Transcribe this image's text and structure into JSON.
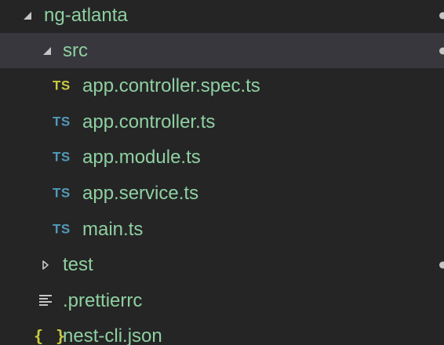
{
  "explorer": {
    "root": {
      "label": "ng-atlanta",
      "expanded": true
    },
    "src_folder": {
      "label": "src",
      "expanded": true
    },
    "src_files": [
      {
        "label": "app.controller.spec.ts",
        "icon": "TS",
        "icon_color": "#cbcb41"
      },
      {
        "label": "app.controller.ts",
        "icon": "TS",
        "icon_color": "#519aba"
      },
      {
        "label": "app.module.ts",
        "icon": "TS",
        "icon_color": "#519aba"
      },
      {
        "label": "app.service.ts",
        "icon": "TS",
        "icon_color": "#519aba"
      },
      {
        "label": "main.ts",
        "icon": "TS",
        "icon_color": "#519aba"
      }
    ],
    "test_folder": {
      "label": "test",
      "expanded": false
    },
    "prettierrc": {
      "label": ".prettierrc"
    },
    "nest_cli": {
      "label": "nest-cli.json",
      "icon": "{ }"
    }
  },
  "colors": {
    "background": "#252526",
    "selected_row": "#37373d",
    "label_text": "#8fd0a1",
    "twisty": "#c5c5c5",
    "ts_spec_icon": "#cbcb41",
    "ts_icon": "#519aba",
    "json_icon": "#cbcb41"
  }
}
